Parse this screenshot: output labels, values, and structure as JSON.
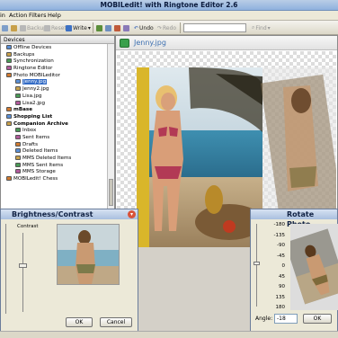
{
  "window": {
    "title": "MOBILedit! with Ringtone Editor 2.6"
  },
  "menu": [
    {
      "label": "in"
    },
    {
      "label": "Action"
    },
    {
      "label": "Filters"
    },
    {
      "label": "Help"
    }
  ],
  "toolbar": {
    "backup": "Backup",
    "reset": "Reset",
    "write": "Write",
    "undo": "Undo",
    "redo": "Redo",
    "find": "Find"
  },
  "devices": {
    "header": "Devices",
    "items": [
      {
        "label": "Offline Devices",
        "level": 1,
        "bold": false,
        "selected": false
      },
      {
        "label": "Backups",
        "level": 1,
        "bold": false,
        "selected": false
      },
      {
        "label": "Synchronization",
        "level": 1,
        "bold": false,
        "selected": false
      },
      {
        "label": "Ringtone Editor",
        "level": 1,
        "bold": false,
        "selected": false
      },
      {
        "label": "Photo MOBILeditor",
        "level": 1,
        "bold": false,
        "selected": false
      },
      {
        "label": "Jenny.jpg",
        "level": 2,
        "bold": false,
        "selected": true
      },
      {
        "label": "Jenny2.jpg",
        "level": 2,
        "bold": false,
        "selected": false
      },
      {
        "label": "Lisa.jpg",
        "level": 2,
        "bold": false,
        "selected": false
      },
      {
        "label": "Lisa2.jpg",
        "level": 2,
        "bold": false,
        "selected": false
      },
      {
        "label": "mBase",
        "level": 1,
        "bold": true,
        "selected": false
      },
      {
        "label": "Shopping List",
        "level": 1,
        "bold": true,
        "selected": false
      },
      {
        "label": "Companion Archive",
        "level": 1,
        "bold": true,
        "selected": false
      },
      {
        "label": "Inbox",
        "level": 2,
        "bold": false,
        "selected": false
      },
      {
        "label": "Sent Items",
        "level": 2,
        "bold": false,
        "selected": false
      },
      {
        "label": "Drafts",
        "level": 2,
        "bold": false,
        "selected": false
      },
      {
        "label": "Deleted Items",
        "level": 2,
        "bold": false,
        "selected": false
      },
      {
        "label": "MMS Deleted Items",
        "level": 2,
        "bold": false,
        "selected": false
      },
      {
        "label": "MMS Sent Items",
        "level": 2,
        "bold": false,
        "selected": false
      },
      {
        "label": "MMS Storage",
        "level": 2,
        "bold": false,
        "selected": false
      },
      {
        "label": "MOBILedit! Chess",
        "level": 1,
        "bold": false,
        "selected": false
      }
    ]
  },
  "image": {
    "filename": "Jenny.jpg"
  },
  "brightness": {
    "title": "Brightness/Contrast",
    "contrast_label": "Contrast",
    "ok": "OK",
    "cancel": "Cancel"
  },
  "rotate": {
    "title": "Rotate Photo",
    "ticks": [
      "-180",
      "-135",
      "-90",
      "-45",
      "0",
      "45",
      "90",
      "135",
      "180"
    ],
    "angle_label": "Angle:",
    "angle_value": "-18",
    "ok": "OK"
  },
  "colors": {
    "accent": "#316ac5",
    "title_gradient_top": "#b9cde6",
    "title_gradient_bottom": "#8fb1de"
  }
}
